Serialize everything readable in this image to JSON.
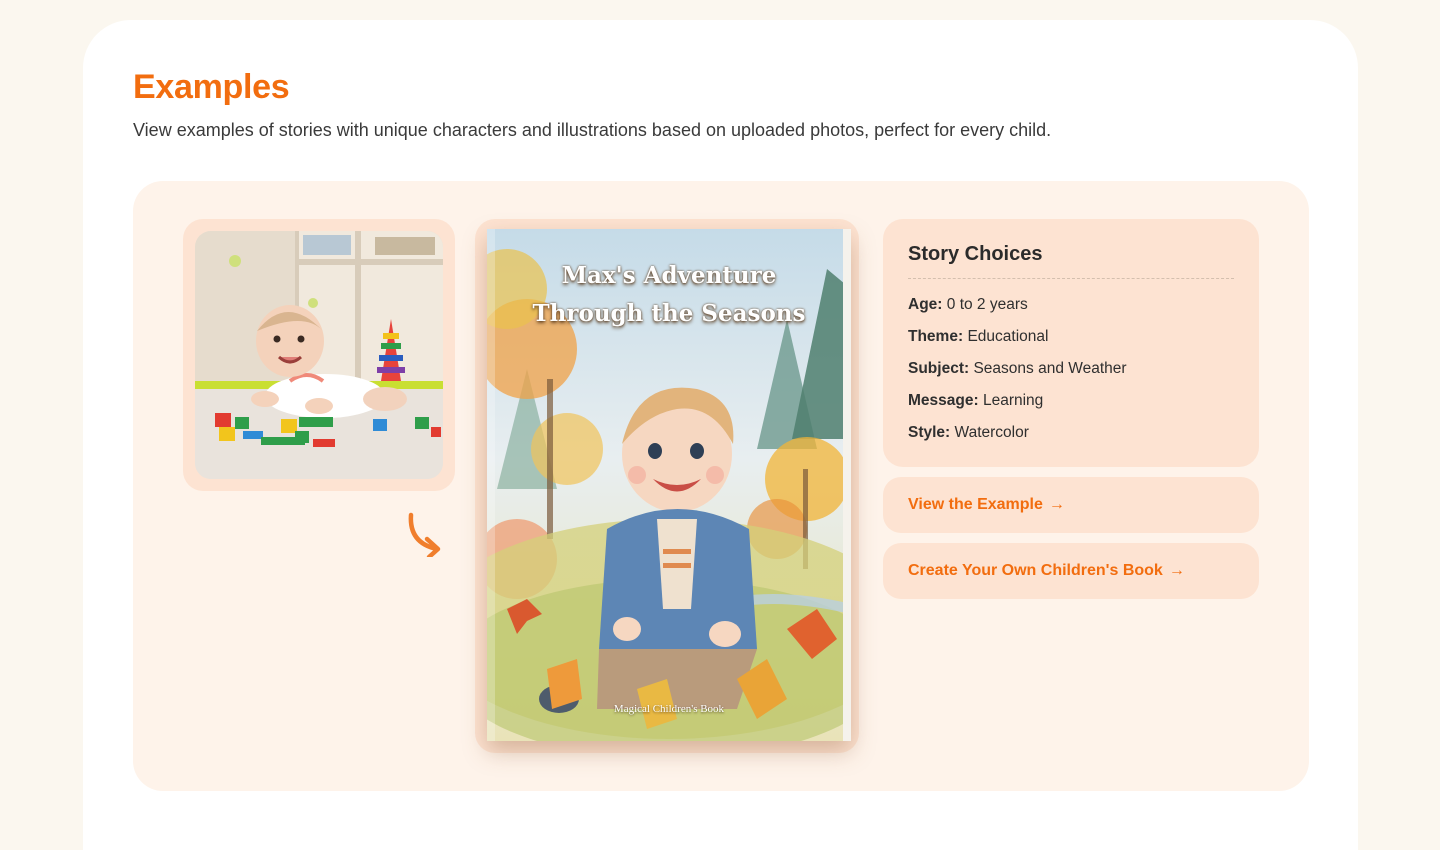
{
  "section": {
    "title": "Examples",
    "description": "View examples of stories with unique characters and illustrations based on uploaded photos, perfect for every child."
  },
  "example": {
    "photo_alt": "Baby crawling on floor with colorful building blocks",
    "book": {
      "title_line1": "Max's Adventure",
      "title_line2": "Through the Seasons",
      "footer": "Magical Children's Book"
    },
    "story_choices": {
      "title": "Story Choices",
      "rows": [
        {
          "label": "Age:",
          "value": "0 to 2 years"
        },
        {
          "label": "Theme:",
          "value": "Educational"
        },
        {
          "label": "Subject:",
          "value": "Seasons and Weather"
        },
        {
          "label": "Message:",
          "value": "Learning"
        },
        {
          "label": "Style:",
          "value": "Watercolor"
        }
      ]
    },
    "buttons": {
      "view": "View the Example",
      "create": "Create Your Own Children's Book",
      "arrow": "→"
    }
  },
  "colors": {
    "accent": "#f26d0f",
    "panel": "#fef3ea",
    "card": "#fde3d2",
    "page_bg": "#fbf7ef"
  },
  "icons": [
    "curved-arrow-icon",
    "arrow-right-icon"
  ]
}
